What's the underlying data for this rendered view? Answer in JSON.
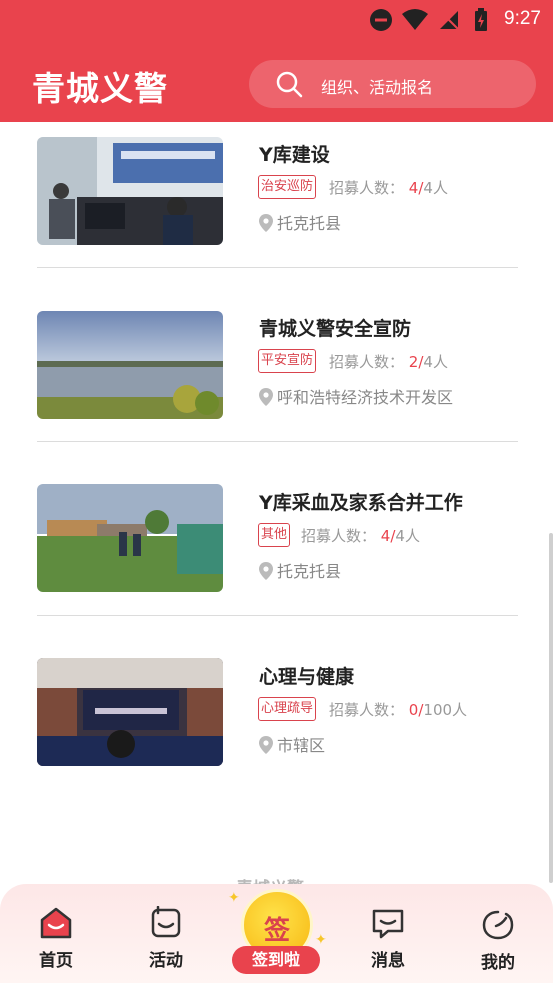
{
  "status_bar": {
    "time": "9:27"
  },
  "header": {
    "title": "青城义警",
    "search_placeholder": "组织、活动报名"
  },
  "activities": [
    {
      "title": "Y库建设",
      "tag": "治安巡防",
      "recruit_label": "招募人数：",
      "current": "4",
      "separator": "/",
      "total": "4人",
      "location": "托克托县"
    },
    {
      "title": "青城义警安全宣防",
      "tag": "平安宣防",
      "recruit_label": "招募人数：",
      "current": "2",
      "separator": "/",
      "total": "4人",
      "location": "呼和浩特经济技术开发区"
    },
    {
      "title": "Y库采血及家系合并工作",
      "tag": "其他",
      "recruit_label": "招募人数：",
      "current": "4",
      "separator": "/",
      "total": "4人",
      "location": "托克托县"
    },
    {
      "title": "心理与健康",
      "tag": "心理疏导",
      "recruit_label": "招募人数：",
      "current": "0",
      "separator": "/",
      "total": "100人",
      "location": "市辖区"
    }
  ],
  "footer_watermark": "青城义警",
  "tabbar": {
    "home": "首页",
    "activity": "活动",
    "checkin_glyph": "签",
    "checkin": "签到啦",
    "messages": "消息",
    "mine": "我的"
  },
  "colors": {
    "brand": "#e9434d",
    "accent_yellow": "#f7b712"
  }
}
